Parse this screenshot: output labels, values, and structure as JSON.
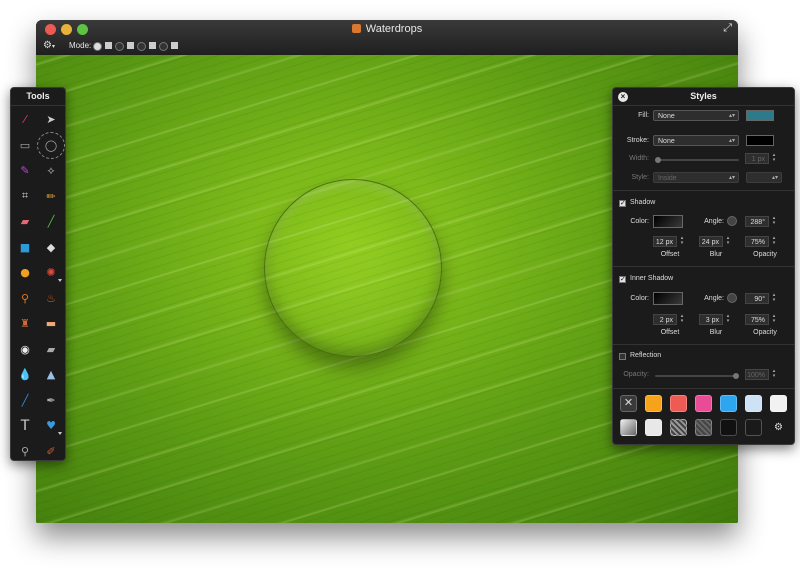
{
  "window": {
    "title": "Waterdrops",
    "mode_label": "Mode:"
  },
  "tools": {
    "title": "Tools",
    "items": [
      {
        "name": "magic-wand",
        "color": "#d0447a"
      },
      {
        "name": "arrow",
        "color": "#cccccc"
      },
      {
        "name": "rect-select",
        "color": "#aaaaaa"
      },
      {
        "name": "ellipse-select",
        "color": "#aaaaaa"
      },
      {
        "name": "brush-select",
        "color": "#b44ad0"
      },
      {
        "name": "lasso",
        "color": "#aaaaaa"
      },
      {
        "name": "crop",
        "color": "#cccccc"
      },
      {
        "name": "pencil",
        "color": "#e2a83a"
      },
      {
        "name": "eraser",
        "color": "#e36a74"
      },
      {
        "name": "line",
        "color": "#5ab84a"
      },
      {
        "name": "rectangle",
        "color": "#2e9ad6"
      },
      {
        "name": "paint-bucket",
        "color": "#dddddd"
      },
      {
        "name": "ellipse",
        "color": "#f0a020"
      },
      {
        "name": "color-picker",
        "color": "#e24a3a"
      },
      {
        "name": "broom",
        "color": "#e07a20"
      },
      {
        "name": "burn",
        "color": "#e05a10"
      },
      {
        "name": "stamp",
        "color": "#d06a3a"
      },
      {
        "name": "bandage",
        "color": "#f0a878"
      },
      {
        "name": "red-eye",
        "color": "#eeeeee"
      },
      {
        "name": "smudge",
        "color": "#aaaaaa"
      },
      {
        "name": "blur-drop",
        "color": "#3a9ae0"
      },
      {
        "name": "sharpen",
        "color": "#9ac0e8"
      },
      {
        "name": "pen",
        "color": "#3a8ad6"
      },
      {
        "name": "vector-pen",
        "color": "#aaaaaa"
      },
      {
        "name": "text",
        "color": "#cccccc"
      },
      {
        "name": "heart-shape",
        "color": "#3a9ae0"
      },
      {
        "name": "zoom",
        "color": "#aaaaaa"
      },
      {
        "name": "eyedropper",
        "color": "#d05a30"
      }
    ]
  },
  "styles": {
    "title": "Styles",
    "fill": {
      "label": "Fill:",
      "value": "None",
      "color": "#2d7a8a"
    },
    "stroke": {
      "label": "Stroke:",
      "value": "None",
      "color": "#000000"
    },
    "width": {
      "label": "Width:",
      "value": "1 px"
    },
    "style": {
      "label": "Style:",
      "value": "Inside"
    },
    "shadow": {
      "label": "Shadow",
      "checked": true,
      "color_label": "Color:",
      "angle_label": "Angle:",
      "angle": "288°",
      "offset": "12 px",
      "blur": "24 px",
      "opacity": "75%",
      "offset_label": "Offset",
      "blur_label": "Blur",
      "opacity_label": "Opacity"
    },
    "inner_shadow": {
      "label": "Inner Shadow",
      "checked": true,
      "color_label": "Color:",
      "angle_label": "Angle:",
      "angle": "90°",
      "offset": "2 px",
      "blur": "3 px",
      "opacity": "75%",
      "offset_label": "Offset",
      "blur_label": "Blur",
      "opacity_label": "Opacity"
    },
    "reflection": {
      "label": "Reflection",
      "checked": false,
      "opacity_label": "Opacity:",
      "opacity": "100%"
    },
    "presets_row1": [
      "#444444",
      "#f7a21b",
      "#ee5b55",
      "#e94c95",
      "#2ea6ef",
      "#cfe1f5",
      "#f2f2f2"
    ],
    "presets_row2": [
      "#bbbbbb",
      "#e8e8e8",
      "#999999",
      "#666666",
      "#111111",
      "#1a1a1a",
      "#1b1b1b"
    ]
  }
}
